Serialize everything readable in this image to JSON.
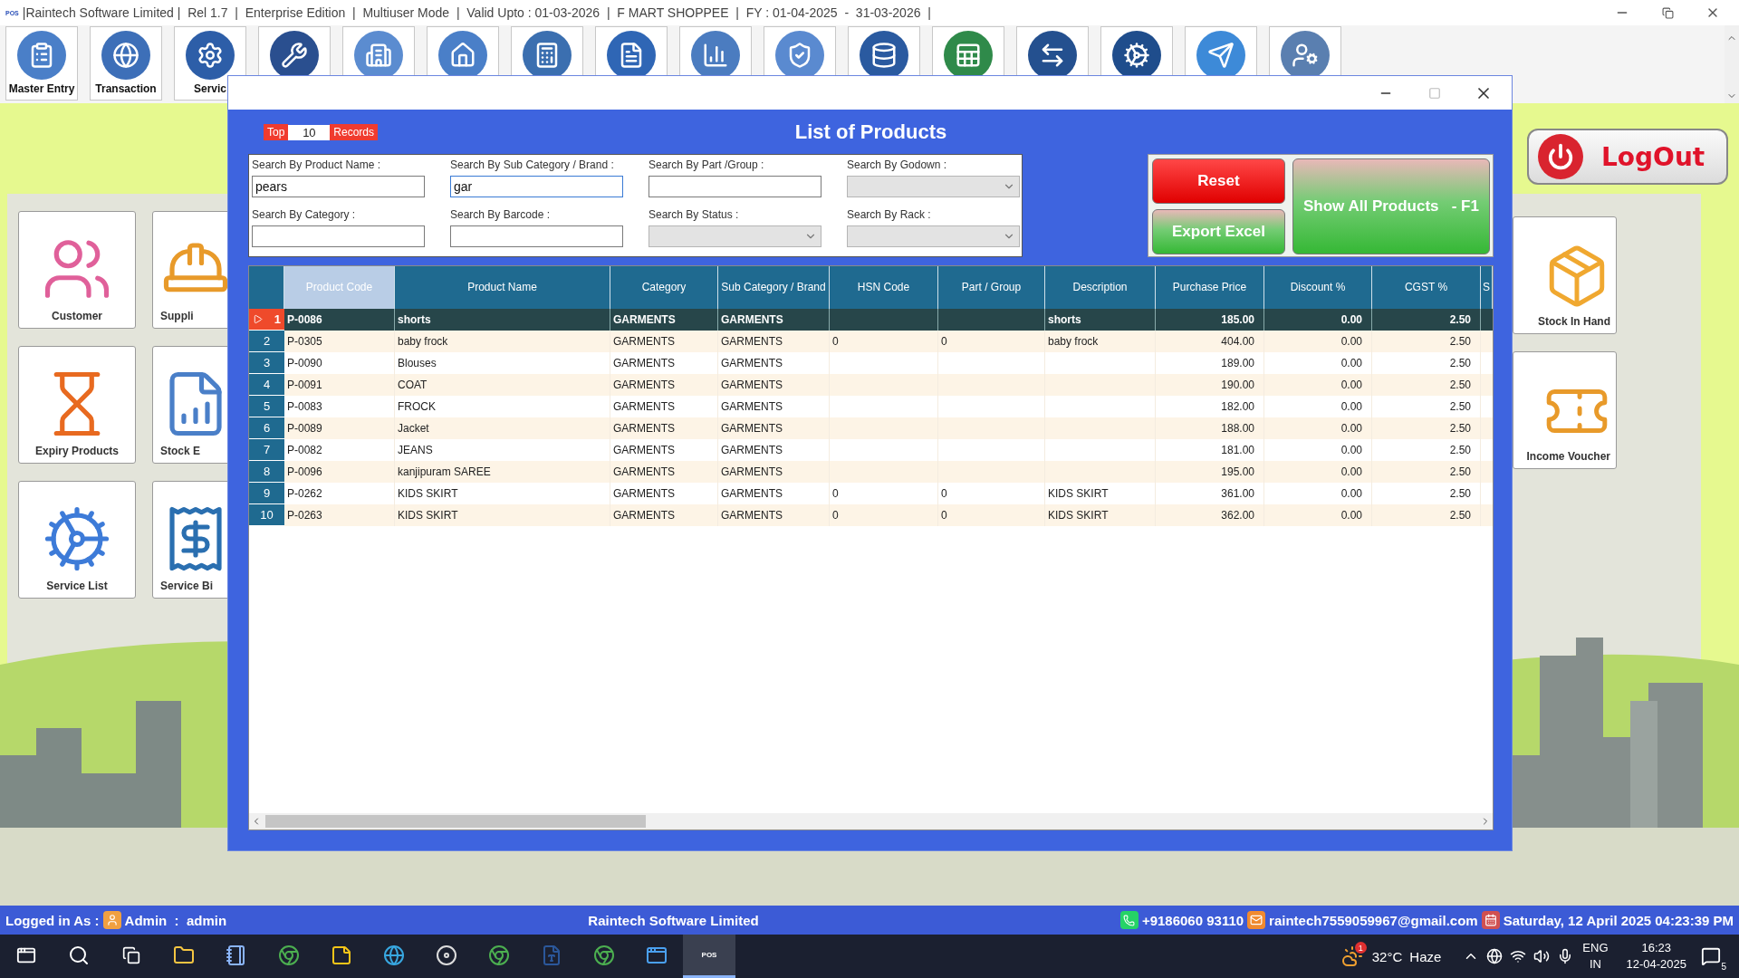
{
  "app_window": {
    "logo": "POS",
    "title": "|Raintech Software Limited |  Rel 1.7  |  Enterprise Edition  |  Multiuser Mode  |  Valid Upto : 01-03-2026  |  F MART SHOPPEE  |  FY : 01-04-2025  -  31-03-2026  |"
  },
  "toolbar": [
    {
      "kind": "labeled",
      "label": "Master Entry"
    },
    {
      "kind": "labeled",
      "label": "Transaction"
    },
    {
      "kind": "labeled",
      "label": "Servic"
    },
    {
      "kind": "icon"
    },
    {
      "kind": "icon"
    },
    {
      "kind": "icon"
    },
    {
      "kind": "icon"
    },
    {
      "kind": "icon"
    },
    {
      "kind": "icon"
    },
    {
      "kind": "icon"
    },
    {
      "kind": "icon"
    },
    {
      "kind": "icon"
    },
    {
      "kind": "icon"
    },
    {
      "kind": "icon"
    },
    {
      "kind": "icon"
    },
    {
      "kind": "icon"
    }
  ],
  "logout_button": {
    "label": "LogOut"
  },
  "left_tiles": [
    {
      "label": "Customer"
    },
    {
      "label": "Suppli"
    },
    {
      "label": "Expiry Products"
    },
    {
      "label": "Stock E"
    },
    {
      "label": "Service List"
    },
    {
      "label": "Service Bi"
    }
  ],
  "right_tiles": [
    {
      "label": "Stock In Hand"
    },
    {
      "label": "Income Voucher"
    }
  ],
  "dialog": {
    "title": "List of Products",
    "top_label": "Top",
    "top_value": "10",
    "records_label": "Records",
    "search_fields": [
      {
        "kind": "text",
        "label": "Search By Product Name :",
        "value": "pears",
        "focused": false
      },
      {
        "kind": "text",
        "label": "Search By Sub Category / Brand :",
        "value": "gar",
        "focused": true
      },
      {
        "kind": "text",
        "label": "Search By Part /Group :",
        "focused": false
      },
      {
        "kind": "dropdown",
        "label": "Search By Godown :",
        "disabled": true
      },
      {
        "kind": "text",
        "label": "Search By Category :",
        "focused": false
      },
      {
        "kind": "text",
        "label": "Search By Barcode :",
        "focused": false
      },
      {
        "kind": "dropdown",
        "label": "Search By Status :",
        "disabled": true
      },
      {
        "kind": "dropdown",
        "label": "Search By Rack :",
        "disabled": true
      }
    ],
    "buttons": [
      {
        "kind": "reset",
        "label": "Reset"
      },
      {
        "kind": "show_all",
        "label": "Show All Products   - F1"
      },
      {
        "kind": "export",
        "label": "Export Excel"
      }
    ],
    "table": {
      "columns": [
        {
          "label": "Product Code",
          "selected": true
        },
        {
          "label": "Product Name",
          "selected": false
        },
        {
          "label": "Category",
          "selected": false
        },
        {
          "label": "Sub Category / Brand",
          "selected": false
        },
        {
          "label": "HSN Code",
          "selected": false
        },
        {
          "label": "Part / Group",
          "selected": false
        },
        {
          "label": "Description",
          "selected": false
        },
        {
          "label": "Purchase Price",
          "selected": false
        },
        {
          "label": "Discount %",
          "selected": false
        },
        {
          "label": "CGST %",
          "selected": false
        },
        {
          "label": "S",
          "selected": false
        }
      ],
      "rows": [
        {
          "number": "1",
          "selected": true,
          "code": "P-0086",
          "name": "shorts",
          "category": "GARMENTS",
          "sub_category": "GARMENTS",
          "description": "shorts",
          "price": "185.00",
          "discount": "0.00",
          "cgst": "2.50"
        },
        {
          "number": "2",
          "selected": false,
          "code": "P-0305",
          "name": "baby frock",
          "category": "GARMENTS",
          "sub_category": "GARMENTS",
          "hsn": "0",
          "part_group": "0",
          "description": "baby frock",
          "price": "404.00",
          "discount": "0.00",
          "cgst": "2.50"
        },
        {
          "number": "3",
          "selected": false,
          "code": "P-0090",
          "name": "Blouses",
          "category": "GARMENTS",
          "sub_category": "GARMENTS",
          "price": "189.00",
          "discount": "0.00",
          "cgst": "2.50"
        },
        {
          "number": "4",
          "selected": false,
          "code": "P-0091",
          "name": "COAT",
          "category": "GARMENTS",
          "sub_category": "GARMENTS",
          "price": "190.00",
          "discount": "0.00",
          "cgst": "2.50"
        },
        {
          "number": "5",
          "selected": false,
          "code": "P-0083",
          "name": "FROCK",
          "category": "GARMENTS",
          "sub_category": "GARMENTS",
          "price": "182.00",
          "discount": "0.00",
          "cgst": "2.50"
        },
        {
          "number": "6",
          "selected": false,
          "code": "P-0089",
          "name": "Jacket",
          "category": "GARMENTS",
          "sub_category": "GARMENTS",
          "price": "188.00",
          "discount": "0.00",
          "cgst": "2.50"
        },
        {
          "number": "7",
          "selected": false,
          "code": "P-0082",
          "name": "JEANS",
          "category": "GARMENTS",
          "sub_category": "GARMENTS",
          "price": "181.00",
          "discount": "0.00",
          "cgst": "2.50"
        },
        {
          "number": "8",
          "selected": false,
          "code": "P-0096",
          "name": "kanjipuram SAREE",
          "category": "GARMENTS",
          "sub_category": "GARMENTS",
          "price": "195.00",
          "discount": "0.00",
          "cgst": "2.50"
        },
        {
          "number": "9",
          "selected": false,
          "code": "P-0262",
          "name": "KIDS SKIRT",
          "category": "GARMENTS",
          "sub_category": "GARMENTS",
          "hsn": "0",
          "part_group": "0",
          "description": "KIDS SKIRT",
          "price": "361.00",
          "discount": "0.00",
          "cgst": "2.50"
        },
        {
          "number": "10",
          "selected": false,
          "code": "P-0263",
          "name": "KIDS SKIRT",
          "category": "GARMENTS",
          "sub_category": "GARMENTS",
          "hsn": "0",
          "part_group": "0",
          "description": "KIDS SKIRT",
          "price": "362.00",
          "discount": "0.00",
          "cgst": "2.50"
        }
      ]
    }
  },
  "status_bar": {
    "logged_in_label": "Logged in As :",
    "user": "Admin  :  admin",
    "company": "Raintech Software Limited",
    "phone": "+9186060 93110",
    "email": "raintech7559059967@gmail.com",
    "datetime": "Saturday, 12 April 2025 04:23:39 PM"
  },
  "taskbar": {
    "apps": [
      {
        "kind": "folder",
        "active": false
      },
      {
        "kind": "notepad",
        "active": false
      },
      {
        "kind": "chrome",
        "active": false
      },
      {
        "kind": "notes",
        "active": false
      },
      {
        "kind": "edge",
        "active": false
      },
      {
        "kind": "media",
        "active": false
      },
      {
        "kind": "chrome",
        "active": false
      },
      {
        "kind": "word",
        "active": false
      },
      {
        "kind": "chrome",
        "active": false
      },
      {
        "kind": "app",
        "active": false
      },
      {
        "kind": "pos",
        "active": true,
        "label": "POS"
      }
    ],
    "weather_alert": "1",
    "temperature": "32°C",
    "weather": "Haze",
    "language": "ENG",
    "region": "IN",
    "time": "16:23",
    "date": "12-04-2025",
    "notifications": "5"
  }
}
